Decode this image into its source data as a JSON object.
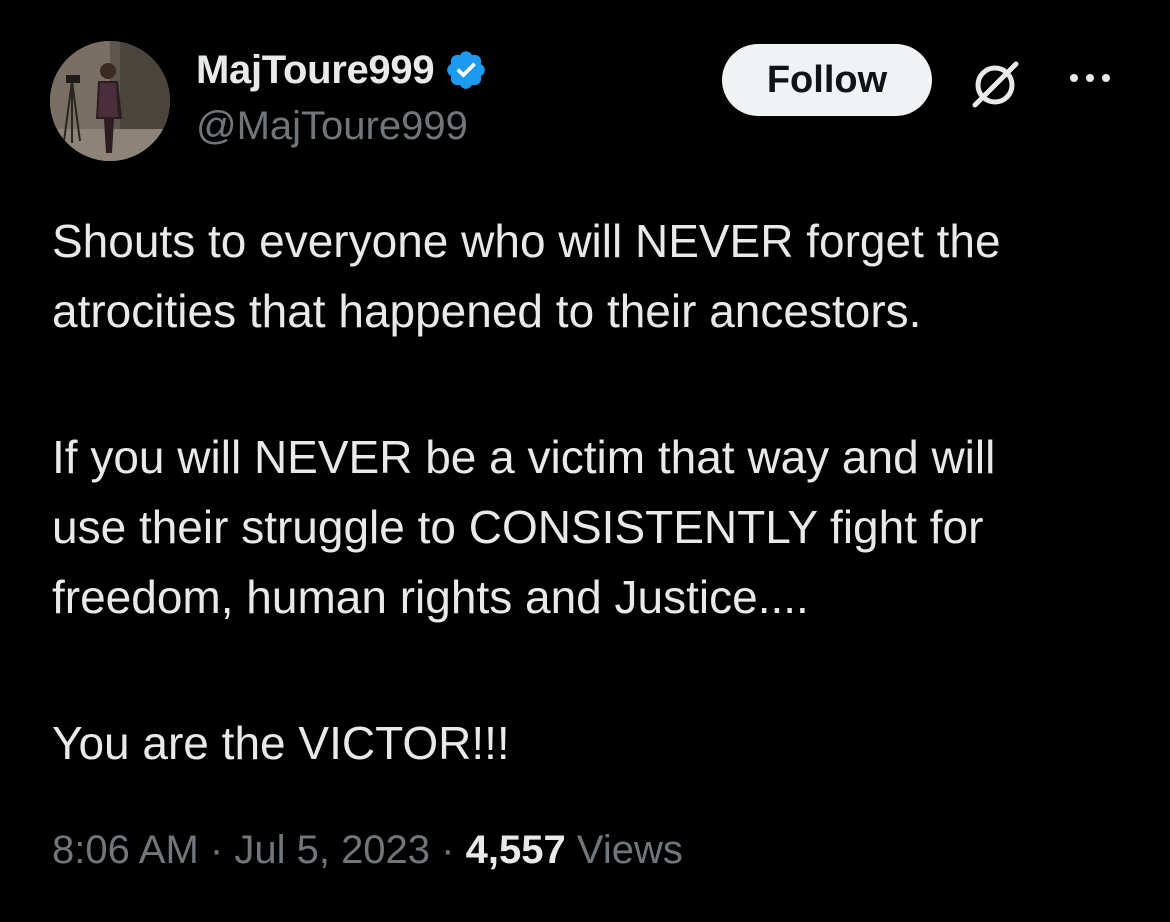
{
  "author": {
    "display_name": "MajToure999",
    "handle": "@MajToure999",
    "verified": true,
    "verified_color": "#1d9bf0"
  },
  "actions": {
    "follow_label": "Follow",
    "grok_icon": "grok-icon",
    "more_icon": "more-icon"
  },
  "tweet": {
    "line1": "Shouts to everyone who will NEVER forget the",
    "line2": "atrocities that happened to their ancestors.",
    "line3": "If you will NEVER be a victim that way and will",
    "line4": "use their struggle to CONSISTENTLY fight for",
    "line5": "freedom, human rights and Justice....",
    "line6": "You are the VICTOR!!!"
  },
  "meta": {
    "time": "8:06 AM",
    "separator": "·",
    "date": "Jul 5, 2023",
    "views_count": "4,557",
    "views_label": "Views"
  },
  "colors": {
    "background": "#000000",
    "text_primary": "#e7e9ea",
    "text_secondary": "#71767b",
    "button_bg": "#eff3f4"
  }
}
